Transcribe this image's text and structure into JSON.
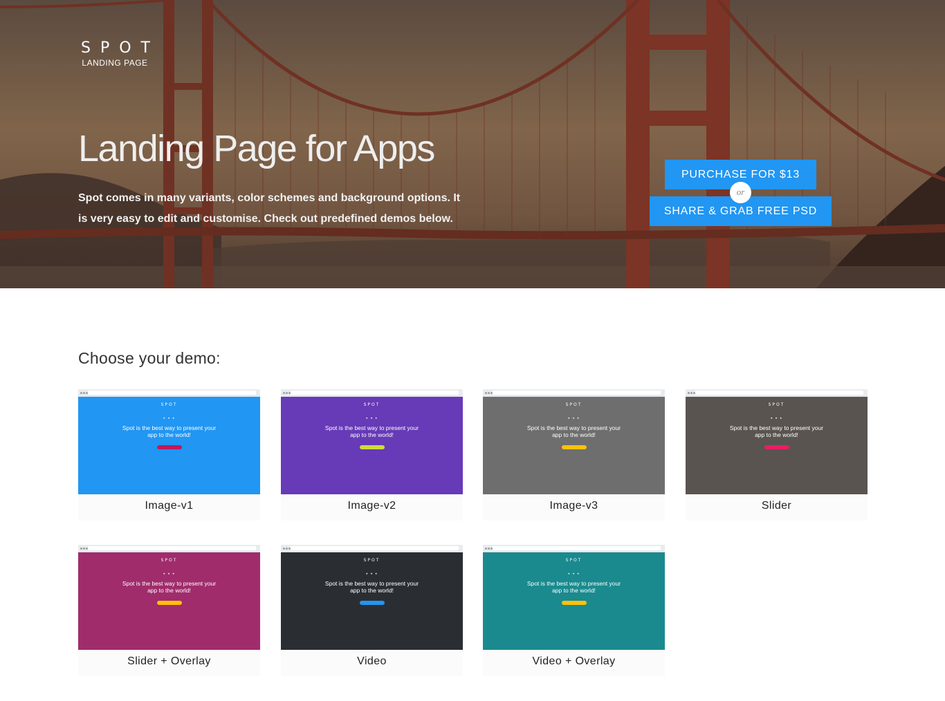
{
  "logo": {
    "word": "SPOT",
    "sub": "LANDING PAGE"
  },
  "hero": {
    "title": "Landing Page for Apps",
    "description": "Spot comes in many variants, color schemes and background options. It is very easy to edit and customise. Check out predefined demos below."
  },
  "cta": {
    "purchase": "PURCHASE FOR $13",
    "or": "or",
    "share": "SHARE & GRAB FREE PSD"
  },
  "demos": {
    "title": "Choose your demo:",
    "items": [
      {
        "label": "Image-v1",
        "mini_logo": "SPOT",
        "mini_text": "Spot is the best way to present your app to the world!",
        "color": "#2196f3",
        "btn_color": "#c2185b"
      },
      {
        "label": "Image-v2",
        "mini_logo": "SPOT",
        "mini_text": "Spot is the best way to present your app to the world!",
        "color": "#673ab7",
        "btn_color": "#cddc39"
      },
      {
        "label": "Image-v3",
        "mini_logo": "SPOT",
        "mini_text": "Spot is the best way to present your app to the world!",
        "color": "#6e6e6e",
        "btn_color": "#ffc107"
      },
      {
        "label": "Slider",
        "mini_logo": "SPOT",
        "mini_text": "Spot is the best way to present your app to the world!",
        "color": "#5a5450",
        "btn_color": "#e91e63"
      },
      {
        "label": "Slider + Overlay",
        "mini_logo": "SPOT",
        "mini_text": "Spot is the best way to present your app to the world!",
        "color": "#a02c6c",
        "btn_color": "#ffc107"
      },
      {
        "label": "Video",
        "mini_logo": "SPOT",
        "mini_text": "Spot is the best way to present your app to the world!",
        "color": "#2a2e33",
        "btn_color": "#2196f3"
      },
      {
        "label": "Video + Overlay",
        "mini_logo": "SPOT",
        "mini_text": "Spot is the best way to present your app to the world!",
        "color": "#1a8a8e",
        "btn_color": "#ffc107"
      }
    ]
  }
}
